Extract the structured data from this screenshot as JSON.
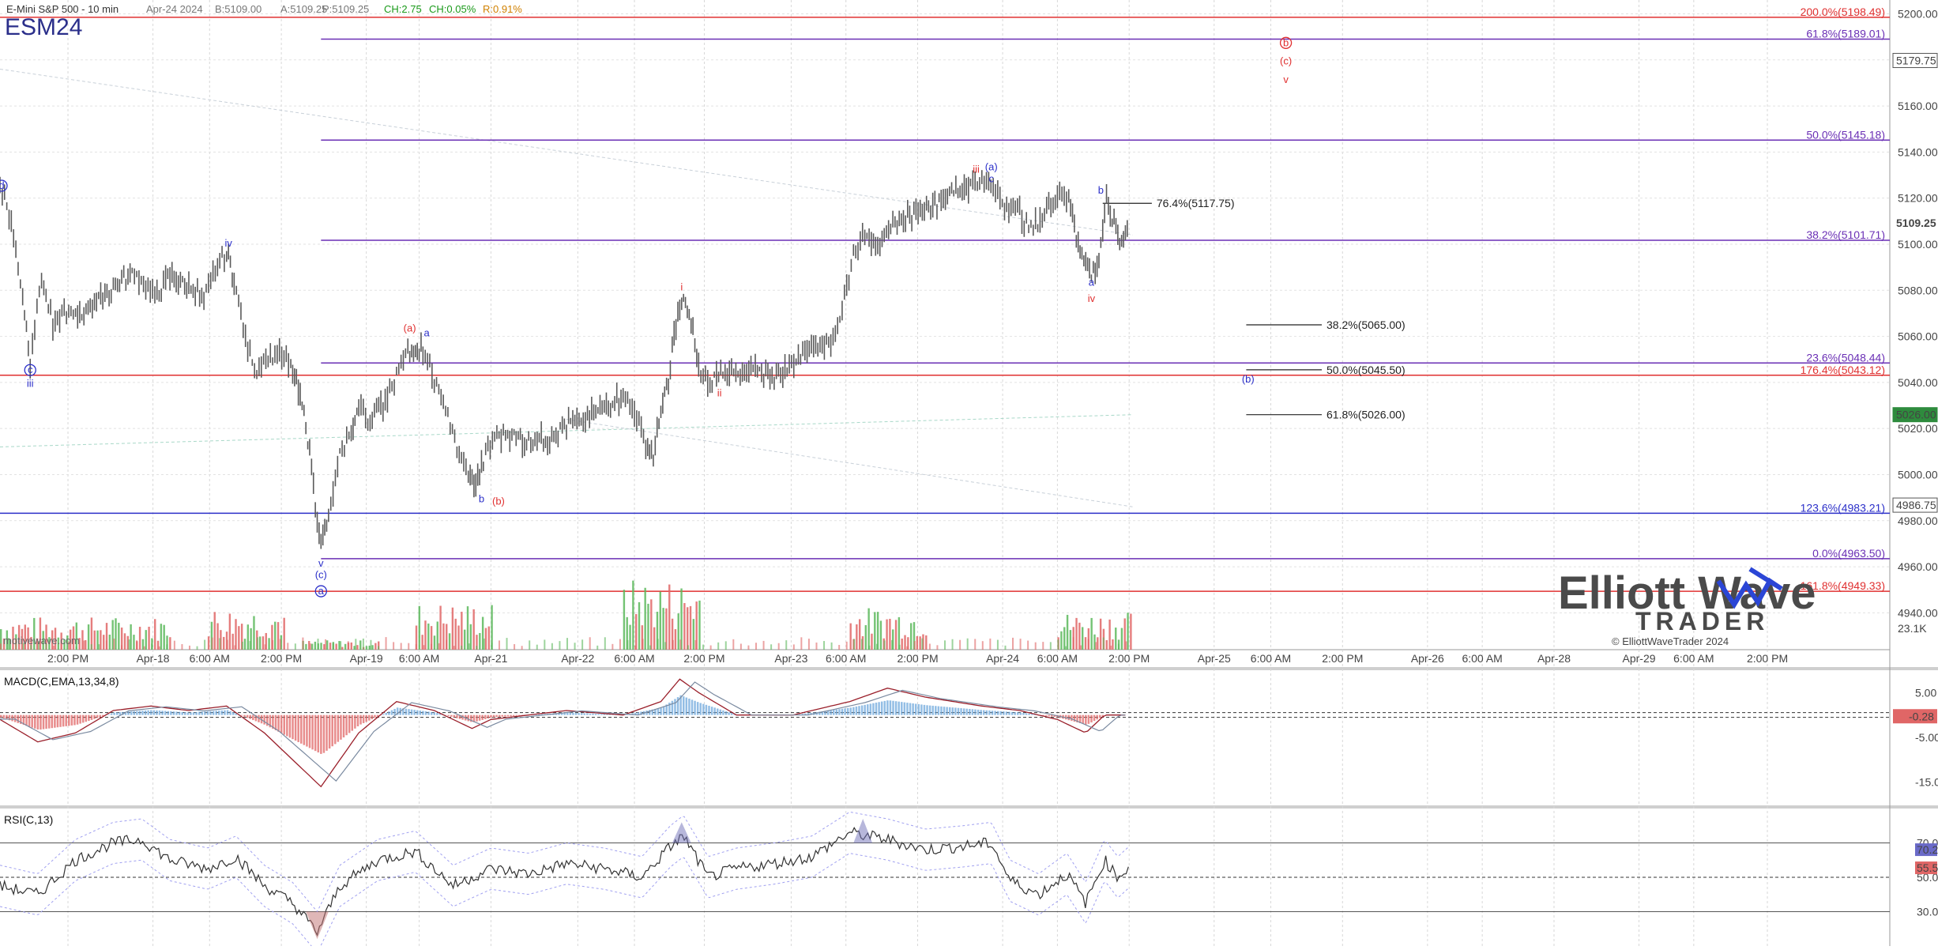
{
  "header": {
    "instrument": "E-Mini S&P 500 - 10 min",
    "date": "Apr-24 2024",
    "bid": "B:5109.00",
    "ask": "A:5109.25",
    "last": "P:5109.25",
    "change": "CH:2.75",
    "change_pct": "CH:0.05%",
    "range": "R:0.91%",
    "symbol": "ESM24"
  },
  "colors": {
    "candle": "#5a5a5a",
    "fib_purple": "#6a2fb5",
    "fib_red": "#e03030",
    "fib_blue": "#2b2fc9",
    "fib_black": "#222222",
    "wave_blue": "#2b2fc9",
    "wave_red": "#e03030",
    "volume_up": "#5cb85c",
    "volume_down": "#e06666",
    "macd_hist_up": "#6fa8dc",
    "macd_hist_down": "#e06666",
    "rsi_line": "#333333",
    "last_price_bg": "#ffffff",
    "green_box": "#2e8b3d"
  },
  "watermark": {
    "site": "motivewave.com",
    "brand_line1": "Elliott Wave",
    "brand_line2": "TRADER",
    "copyright": "© ElliottWaveTrader 2024"
  },
  "chart_data": [
    {
      "type": "line",
      "title": "E-Mini S&P 500 - 10 min",
      "subtitle": "ESM24",
      "price_axis": {
        "ticks": [
          5200.0,
          5180.0,
          5160.0,
          5140.0,
          5120.0,
          5100.0,
          5080.0,
          5060.0,
          5040.0,
          5020.0,
          5000.0,
          4980.0,
          4960.0,
          4940.0
        ],
        "ylim": [
          4924,
          5206
        ],
        "tick_labels": [
          "5200.00",
          "5180.00",
          "5160.00",
          "5140.00",
          "5120.00",
          "5100.00",
          "5080.00",
          "5060.00",
          "5040.00",
          "5020.00",
          "5000.00",
          "4980.00",
          "4960.00",
          "4940.00"
        ],
        "markers": [
          {
            "label": "5179.75",
            "value": 5179.75,
            "style": "box"
          },
          {
            "label": "5109.25",
            "value": 5109.25,
            "style": "bold"
          },
          {
            "label": "5026.00",
            "value": 5026.0,
            "style": "green"
          },
          {
            "label": "4986.75",
            "value": 4986.75,
            "style": "box"
          }
        ]
      },
      "time_axis": {
        "labels": [
          "2:00 PM",
          "Apr-18",
          "6:00 AM",
          "2:00 PM",
          "Apr-19",
          "6:00 AM",
          "Apr-21",
          "Apr-22",
          "6:00 AM",
          "2:00 PM",
          "Apr-23",
          "6:00 AM",
          "2:00 PM",
          "Apr-24",
          "6:00 AM",
          "2:00 PM",
          "Apr-25",
          "6:00 AM",
          "2:00 PM",
          "Apr-26",
          "6:00 AM",
          "Apr-28",
          "Apr-29",
          "6:00 AM",
          "2:00 PM"
        ],
        "positions": [
          0.036,
          0.081,
          0.111,
          0.149,
          0.194,
          0.222,
          0.26,
          0.306,
          0.336,
          0.373,
          0.419,
          0.448,
          0.486,
          0.531,
          0.56,
          0.598,
          0.643,
          0.673,
          0.711,
          0.756,
          0.785,
          0.823,
          0.868,
          0.897,
          0.936
        ]
      },
      "price_series": [
        [
          0.0,
          5126
        ],
        [
          0.006,
          5110
        ],
        [
          0.012,
          5078
        ],
        [
          0.016,
          5050
        ],
        [
          0.022,
          5086
        ],
        [
          0.028,
          5064
        ],
        [
          0.034,
          5072
        ],
        [
          0.04,
          5068
        ],
        [
          0.05,
          5074
        ],
        [
          0.06,
          5082
        ],
        [
          0.07,
          5088
        ],
        [
          0.076,
          5084
        ],
        [
          0.082,
          5078
        ],
        [
          0.09,
          5086
        ],
        [
          0.1,
          5082
        ],
        [
          0.108,
          5076
        ],
        [
          0.114,
          5088
        ],
        [
          0.12,
          5096
        ],
        [
          0.124,
          5086
        ],
        [
          0.13,
          5058
        ],
        [
          0.136,
          5046
        ],
        [
          0.142,
          5052
        ],
        [
          0.148,
          5052
        ],
        [
          0.154,
          5046
        ],
        [
          0.158,
          5036
        ],
        [
          0.162,
          5022
        ],
        [
          0.166,
          4996
        ],
        [
          0.17,
          4968
        ],
        [
          0.174,
          4982
        ],
        [
          0.18,
          5008
        ],
        [
          0.186,
          5018
        ],
        [
          0.19,
          5030
        ],
        [
          0.196,
          5024
        ],
        [
          0.204,
          5032
        ],
        [
          0.21,
          5044
        ],
        [
          0.216,
          5056
        ],
        [
          0.22,
          5052
        ],
        [
          0.224,
          5054
        ],
        [
          0.23,
          5040
        ],
        [
          0.236,
          5030
        ],
        [
          0.242,
          5010
        ],
        [
          0.248,
          5000
        ],
        [
          0.252,
          4996
        ],
        [
          0.256,
          5006
        ],
        [
          0.262,
          5016
        ],
        [
          0.27,
          5018
        ],
        [
          0.28,
          5014
        ],
        [
          0.29,
          5016
        ],
        [
          0.3,
          5022
        ],
        [
          0.31,
          5024
        ],
        [
          0.32,
          5030
        ],
        [
          0.33,
          5034
        ],
        [
          0.336,
          5028
        ],
        [
          0.342,
          5014
        ],
        [
          0.346,
          5008
        ],
        [
          0.35,
          5028
        ],
        [
          0.354,
          5040
        ],
        [
          0.358,
          5066
        ],
        [
          0.362,
          5076
        ],
        [
          0.366,
          5066
        ],
        [
          0.37,
          5046
        ],
        [
          0.376,
          5040
        ],
        [
          0.384,
          5046
        ],
        [
          0.392,
          5042
        ],
        [
          0.4,
          5046
        ],
        [
          0.41,
          5042
        ],
        [
          0.418,
          5046
        ],
        [
          0.424,
          5052
        ],
        [
          0.432,
          5058
        ],
        [
          0.44,
          5056
        ],
        [
          0.446,
          5072
        ],
        [
          0.452,
          5096
        ],
        [
          0.458,
          5104
        ],
        [
          0.466,
          5100
        ],
        [
          0.474,
          5108
        ],
        [
          0.484,
          5114
        ],
        [
          0.494,
          5118
        ],
        [
          0.504,
          5122
        ],
        [
          0.514,
          5126
        ],
        [
          0.52,
          5128
        ],
        [
          0.526,
          5124
        ],
        [
          0.532,
          5118
        ],
        [
          0.54,
          5114
        ],
        [
          0.546,
          5106
        ],
        [
          0.552,
          5112
        ],
        [
          0.56,
          5122
        ],
        [
          0.566,
          5120
        ],
        [
          0.57,
          5104
        ],
        [
          0.574,
          5094
        ],
        [
          0.578,
          5086
        ],
        [
          0.582,
          5094
        ],
        [
          0.586,
          5118
        ],
        [
          0.59,
          5108
        ],
        [
          0.594,
          5100
        ],
        [
          0.598,
          5109
        ]
      ],
      "fib_levels": [
        {
          "label": "200.0%(5198.49)",
          "value": 5198.49,
          "color": "red",
          "x_start": 0.0
        },
        {
          "label": "61.8%(5189.01)",
          "value": 5189.01,
          "color": "purple",
          "x_start": 0.17
        },
        {
          "label": "50.0%(5145.18)",
          "value": 5145.18,
          "color": "purple",
          "x_start": 0.17
        },
        {
          "label": "38.2%(5101.71)",
          "value": 5101.71,
          "color": "purple",
          "x_start": 0.17
        },
        {
          "label": "23.6%(5048.44)",
          "value": 5048.44,
          "color": "purple",
          "x_start": 0.17
        },
        {
          "label": "176.4%(5043.12)",
          "value": 5043.12,
          "color": "red",
          "x_start": 0.0
        },
        {
          "label": "123.6%(4983.21)",
          "value": 4983.21,
          "color": "blue",
          "x_start": 0.0
        },
        {
          "label": "0.0%(4963.50)",
          "value": 4963.5,
          "color": "purple",
          "x_start": 0.17
        },
        {
          "label": "161.8%(4949.33)",
          "value": 4949.33,
          "color": "red",
          "x_start": 0.0
        }
      ],
      "projection_levels": [
        {
          "label": "76.4%(5117.75)",
          "value": 5117.75,
          "x_start": 0.584,
          "x_end": 0.61
        },
        {
          "label": "38.2%(5065.00)",
          "value": 5065.0,
          "x_start": 0.66,
          "x_end": 0.7
        },
        {
          "label": "50.0%(5045.50)",
          "value": 5045.5,
          "x_start": 0.66,
          "x_end": 0.7
        },
        {
          "label": "61.8%(5026.00)",
          "value": 5026.0,
          "x_start": 0.66,
          "x_end": 0.7
        }
      ],
      "wave_labels": [
        {
          "text": "iv",
          "x": 0.121,
          "value": 5099,
          "color": "blue"
        },
        {
          "text": "iii",
          "x": 0.016,
          "value": 5038,
          "color": "blue"
        },
        {
          "text": "(a)",
          "x": 0.217,
          "value": 5062,
          "color": "red"
        },
        {
          "text": "a",
          "x": 0.226,
          "value": 5060,
          "color": "blue"
        },
        {
          "text": "b",
          "x": 0.255,
          "value": 4988,
          "color": "blue"
        },
        {
          "text": "(b)",
          "x": 0.264,
          "value": 4987,
          "color": "red"
        },
        {
          "text": "v",
          "x": 0.17,
          "value": 4960,
          "color": "blue"
        },
        {
          "text": "(c)",
          "x": 0.17,
          "value": 4955,
          "color": "blue"
        },
        {
          "text": "i",
          "x": 0.361,
          "value": 5080,
          "color": "red"
        },
        {
          "text": "ii",
          "x": 0.381,
          "value": 5034,
          "color": "red"
        },
        {
          "text": "iii",
          "x": 0.517,
          "value": 5131,
          "color": "red"
        },
        {
          "text": "(a)",
          "x": 0.525,
          "value": 5132,
          "color": "blue"
        },
        {
          "text": "c",
          "x": 0.525,
          "value": 5127,
          "color": "blue"
        },
        {
          "text": "a",
          "x": 0.578,
          "value": 5082,
          "color": "blue"
        },
        {
          "text": "iv",
          "x": 0.578,
          "value": 5075,
          "color": "red"
        },
        {
          "text": "b",
          "x": 0.583,
          "value": 5122,
          "color": "blue"
        },
        {
          "text": "(b)",
          "x": 0.661,
          "value": 5040,
          "color": "blue"
        },
        {
          "text": "(c)",
          "x": 0.681,
          "value": 5178,
          "color": "red"
        },
        {
          "text": "v",
          "x": 0.681,
          "value": 5170,
          "color": "red"
        }
      ],
      "circled_labels": [
        {
          "text": "b",
          "x": 0.681,
          "value": 5186,
          "color": "red"
        },
        {
          "text": "a",
          "x": 0.17,
          "value": 4948,
          "color": "blue"
        },
        {
          "text": "c",
          "x": 0.016,
          "value": 5044,
          "color": "blue"
        },
        {
          "text": "d",
          "x": 0.0,
          "value": 5124,
          "color": "blue"
        }
      ],
      "volume": {
        "label": "23.1K",
        "clusters": [
          [
            0.0,
            0.09,
            0.35
          ],
          [
            0.11,
            0.15,
            0.45
          ],
          [
            0.16,
            0.2,
            0.1
          ],
          [
            0.22,
            0.26,
            0.5
          ],
          [
            0.33,
            0.37,
            0.75
          ],
          [
            0.45,
            0.49,
            0.45
          ],
          [
            0.56,
            0.6,
            0.4
          ]
        ]
      }
    },
    {
      "type": "line",
      "title": "MACD(C,EMA,13,34,8)",
      "ticks": [
        "5.00",
        "-5.00",
        "-15.00"
      ],
      "tick_values": [
        5,
        -5,
        -15
      ],
      "ylim": [
        -20,
        10
      ],
      "current_value": "-0.28",
      "macd_series": [
        [
          0.0,
          -1
        ],
        [
          0.02,
          -6
        ],
        [
          0.04,
          -4
        ],
        [
          0.06,
          1
        ],
        [
          0.08,
          2
        ],
        [
          0.1,
          1
        ],
        [
          0.12,
          2
        ],
        [
          0.14,
          -4
        ],
        [
          0.16,
          -12
        ],
        [
          0.17,
          -16
        ],
        [
          0.19,
          -4
        ],
        [
          0.21,
          3
        ],
        [
          0.23,
          1
        ],
        [
          0.25,
          -3
        ],
        [
          0.26,
          -1
        ],
        [
          0.3,
          1
        ],
        [
          0.33,
          0
        ],
        [
          0.35,
          3
        ],
        [
          0.36,
          8
        ],
        [
          0.37,
          5
        ],
        [
          0.39,
          0
        ],
        [
          0.42,
          0
        ],
        [
          0.45,
          3
        ],
        [
          0.47,
          6
        ],
        [
          0.49,
          4
        ],
        [
          0.52,
          2
        ],
        [
          0.54,
          1
        ],
        [
          0.56,
          -1
        ],
        [
          0.575,
          -4
        ],
        [
          0.585,
          0
        ],
        [
          0.598,
          0
        ]
      ]
    },
    {
      "type": "line",
      "title": "RSI(C,13)",
      "ticks": [
        "70.0",
        "50.0",
        "30.0"
      ],
      "tick_values": [
        70,
        50,
        30
      ],
      "ylim": [
        10,
        90
      ],
      "current_values": [
        "70.2",
        "55.5"
      ],
      "rsi_series": [
        [
          0.0,
          45
        ],
        [
          0.02,
          40
        ],
        [
          0.04,
          60
        ],
        [
          0.06,
          70
        ],
        [
          0.075,
          72
        ],
        [
          0.09,
          60
        ],
        [
          0.11,
          55
        ],
        [
          0.125,
          62
        ],
        [
          0.14,
          45
        ],
        [
          0.155,
          35
        ],
        [
          0.168,
          18
        ],
        [
          0.18,
          45
        ],
        [
          0.2,
          60
        ],
        [
          0.22,
          65
        ],
        [
          0.24,
          45
        ],
        [
          0.26,
          55
        ],
        [
          0.28,
          52
        ],
        [
          0.3,
          58
        ],
        [
          0.32,
          55
        ],
        [
          0.34,
          50
        ],
        [
          0.355,
          68
        ],
        [
          0.362,
          74
        ],
        [
          0.375,
          50
        ],
        [
          0.39,
          55
        ],
        [
          0.41,
          58
        ],
        [
          0.43,
          62
        ],
        [
          0.45,
          76
        ],
        [
          0.47,
          72
        ],
        [
          0.49,
          66
        ],
        [
          0.51,
          68
        ],
        [
          0.525,
          70
        ],
        [
          0.535,
          48
        ],
        [
          0.55,
          40
        ],
        [
          0.565,
          52
        ],
        [
          0.575,
          35
        ],
        [
          0.585,
          60
        ],
        [
          0.592,
          50
        ],
        [
          0.598,
          56
        ]
      ]
    }
  ]
}
